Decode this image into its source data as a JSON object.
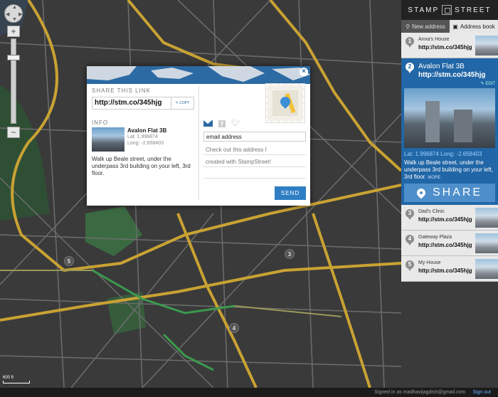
{
  "app": {
    "logo_text_left": "STAMP",
    "logo_text_right": "STREET"
  },
  "map": {
    "scale_label": "600 ft",
    "markers": [
      "5",
      "3",
      "4"
    ]
  },
  "sidebar": {
    "tabs": [
      {
        "label": "New address",
        "icon": "pin-icon",
        "active": false
      },
      {
        "label": "Address book",
        "icon": "book-icon",
        "active": true
      }
    ],
    "items": [
      {
        "num": "1",
        "name": "Anna's House",
        "link": "http://stm.co/345hjg"
      },
      {
        "num": "2",
        "name": "Avalon Flat 3B",
        "link": "http://stm.co/345hjg",
        "edit_label": "EDIT",
        "lat_label": "Lat: 1.996874",
        "long_label": "Long: -2.658403",
        "description": "Walk up Beale street, under the underpass 3rd building on your left, 3rd floor.",
        "more_label": "MORE",
        "share_label": "SHARE",
        "selected": true
      },
      {
        "num": "3",
        "name": "Dad's Clinic",
        "link": "http://stm.co/345hjg"
      },
      {
        "num": "4",
        "name": "Gateway Plaza",
        "link": "http://stm.co/345hjg"
      },
      {
        "num": "5",
        "name": "My House",
        "link": "http://stm.co/345hjg"
      }
    ]
  },
  "modal": {
    "share_label": "SHARE THIS LINK",
    "link": "http://stm.co/345hjg",
    "copy_label": "✎ COPY",
    "info_label": "INFO",
    "info_name": "Avalon Flat 3B",
    "info_lat": "Lat: 1.996874",
    "info_long": "Long: -2.658403",
    "info_desc": "Walk up Beale street, under the underpass 3rd building on your left, 3rd floor.",
    "email_placeholder": "email address",
    "message_line1": "Check out this address I",
    "message_line2": "created with StampStreet!",
    "send_label": "SEND",
    "close_label": "×"
  },
  "status": {
    "signed_in_text": "Signed in as madhavijagdish@gmail.com",
    "signout_label": "Sign out"
  },
  "colors": {
    "accent": "#2166a6",
    "send": "#2f7ec4",
    "map_road": "#c9a233",
    "map_park": "#3f7a45"
  }
}
